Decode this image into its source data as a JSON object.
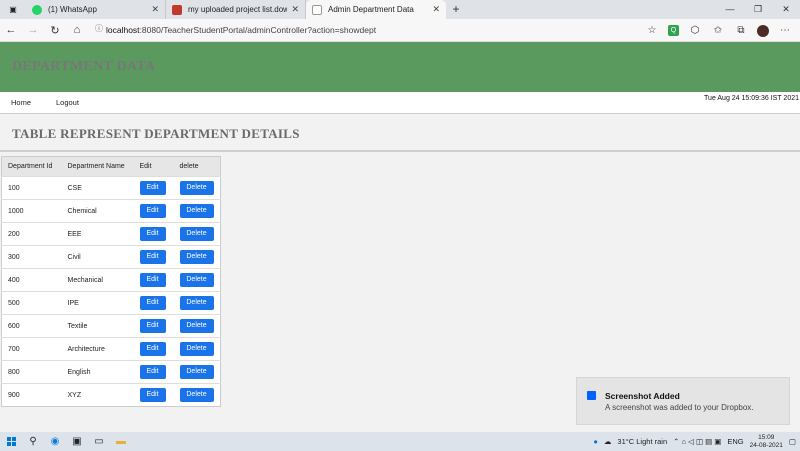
{
  "browser": {
    "tabs": [
      {
        "title": "(1) WhatsApp",
        "icon": "whatsapp-icon",
        "color": "#25d366"
      },
      {
        "title": "my uploaded project list.downlo",
        "icon": "page-icon",
        "color": "#c0392b"
      },
      {
        "title": "Admin Department Data",
        "icon": "page-icon",
        "color": "#888888"
      }
    ],
    "url_host": "localhost",
    "url_rest": ":8080/TeacherStudentPortal/adminController?action=showdept"
  },
  "header": {
    "title": "DEPARTMENT DATA",
    "bg_color": "#5a9a5e"
  },
  "menu": {
    "home": "Home",
    "logout": "Logout",
    "datetime": "Tue Aug 24 15:09:36 IST 2021"
  },
  "section": {
    "title": "TABLE REPRESENT DEPARTMENT DETAILS"
  },
  "table": {
    "headers": [
      "Department Id",
      "Department Name",
      "Edit",
      "delete"
    ],
    "edit_label": "Edit",
    "delete_label": "Delete",
    "button_color": "#1a73e8",
    "rows": [
      {
        "id": "100",
        "name": "CSE"
      },
      {
        "id": "1000",
        "name": "Chemical"
      },
      {
        "id": "200",
        "name": "EEE"
      },
      {
        "id": "300",
        "name": "Civil"
      },
      {
        "id": "400",
        "name": "Mechanical"
      },
      {
        "id": "500",
        "name": "IPE"
      },
      {
        "id": "600",
        "name": "Textile"
      },
      {
        "id": "700",
        "name": "Architecture"
      },
      {
        "id": "800",
        "name": "English"
      },
      {
        "id": "900",
        "name": "XYZ"
      }
    ]
  },
  "toast": {
    "title": "Screenshot Added",
    "message": "A screenshot was added to your Dropbox."
  },
  "taskbar": {
    "weather": "31°C  Light rain",
    "lang": "ENG",
    "time": "15:09",
    "date": "24-08-2021"
  }
}
